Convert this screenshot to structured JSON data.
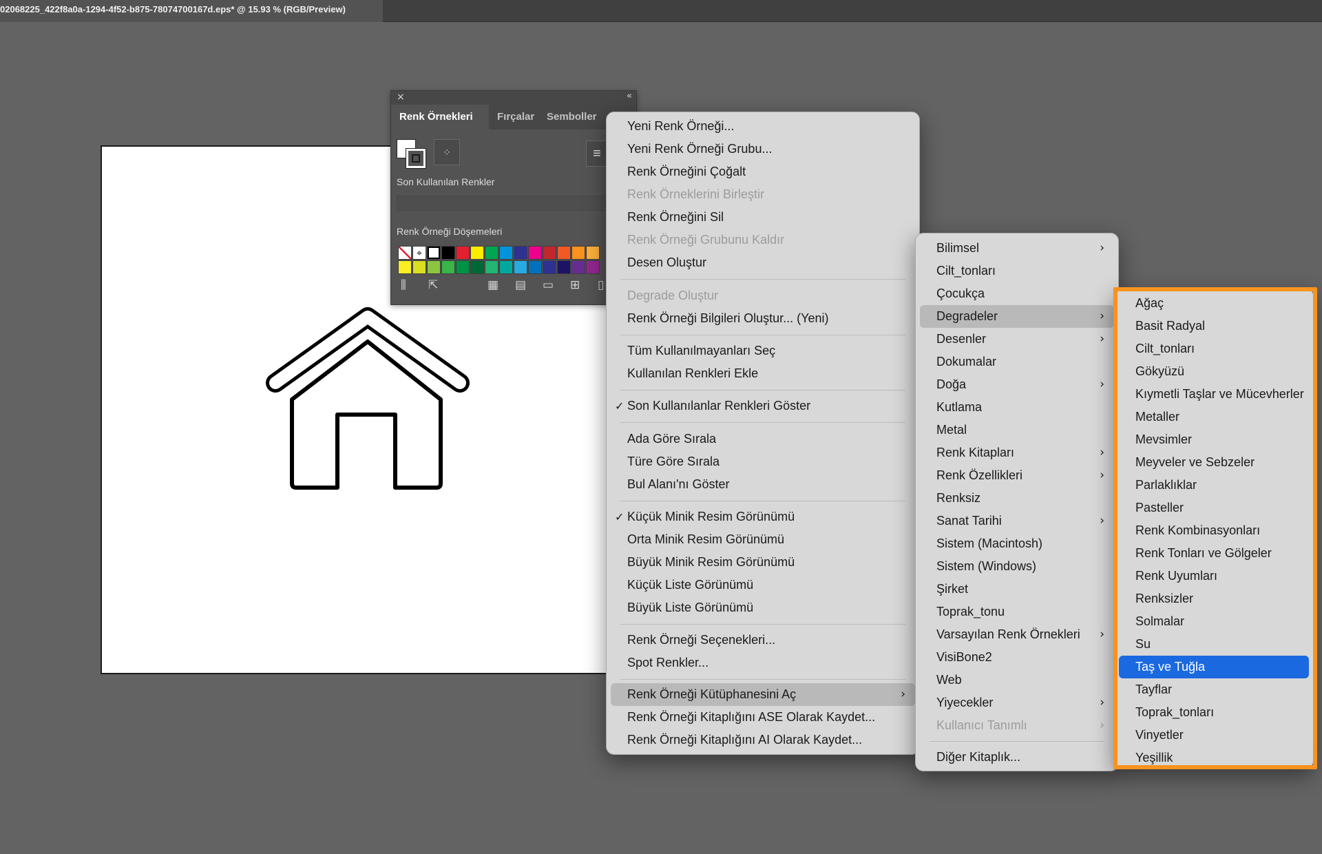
{
  "window": {
    "doc_tab_title": "02068225_422f8a0a-1294-4f52-b875-78074700167d.eps* @ 15.93 % (RGB/Preview)"
  },
  "panel": {
    "tabs": [
      "Renk Örnekleri",
      "Fırçalar",
      "Semboller"
    ],
    "recent_label": "Son Kullanılan Renkler",
    "swatches_label": "Renk Örneği Döşemeleri",
    "swatch_row1": [
      "none",
      "registration",
      "#ffffff",
      "#000000",
      "#e5202e",
      "#ffed00",
      "#00a651",
      "#0095da",
      "#2e3192",
      "#ec008c",
      "#c1272d",
      "#f15a24",
      "#f7931e",
      "#fbb03b"
    ],
    "swatch_row2": [
      "#fcee21",
      "#d9e021",
      "#8cc63f",
      "#39b54a",
      "#009245",
      "#006837",
      "#22b573",
      "#00a99d",
      "#29abe2",
      "#0071bc",
      "#2e3192",
      "#1b1464",
      "#662d91",
      "#93278f"
    ]
  },
  "main_menu": {
    "items": [
      "Yeni Renk Örneği...",
      "Yeni Renk Örneği Grubu...",
      "Renk Örneğini Çoğalt",
      "Renk Örneklerini Birleştir",
      "Renk Örneğini Sil",
      "Renk Örneği Grubunu Kaldır",
      "Desen Oluştur",
      "Degrade Oluştur",
      "Renk Örneği Bilgileri Oluştur... (Yeni)",
      "Tüm Kullanılmayanları Seç",
      "Kullanılan Renkleri Ekle",
      "Son Kullanılanlar Renkleri Göster",
      "Ada Göre Sırala",
      "Türe Göre Sırala",
      "Bul Alanı'nı Göster",
      "Küçük Minik Resim Görünümü",
      "Orta Minik Resim Görünümü",
      "Büyük Minik Resim Görünümü",
      "Küçük Liste Görünümü",
      "Büyük Liste Görünümü",
      "Renk Örneği Seçenekleri...",
      "Spot Renkler...",
      "Renk Örneği Kütüphanesini Aç",
      "Renk Örneği Kitaplığını ASE Olarak Kaydet...",
      "Renk Örneği Kitaplığını AI Olarak Kaydet..."
    ],
    "check_mark": "✓",
    "chevron": "›"
  },
  "library_menu": {
    "items": [
      "Bilimsel",
      "Cilt_tonları",
      "Çocukça",
      "Degradeler",
      "Desenler",
      "Dokumalar",
      "Doğa",
      "Kutlama",
      "Metal",
      "Renk Kitapları",
      "Renk Özellikleri",
      "Renksiz",
      "Sanat Tarihi",
      "Sistem (Macintosh)",
      "Sistem (Windows)",
      "Şirket",
      "Toprak_tonu",
      "Varsayılan Renk Örnekleri",
      "VisiBone2",
      "Web",
      "Yiyecekler",
      "Kullanıcı Tanımlı",
      "Diğer Kitaplık..."
    ]
  },
  "gradient_menu": {
    "items": [
      "Ağaç",
      "Basit Radyal",
      "Cilt_tonları",
      "Gökyüzü",
      "Kıymetli Taşlar ve Mücevherler",
      "Metaller",
      "Mevsimler",
      "Meyveler ve Sebzeler",
      "Parlaklıklar",
      "Pasteller",
      "Renk Kombinasyonları",
      "Renk Tonları ve Gölgeler",
      "Renk Uyumları",
      "Renksizler",
      "Solmalar",
      "Su",
      "Taş ve Tuğla",
      "Tayflar",
      "Toprak_tonları",
      "Vinyetler",
      "Yeşillik"
    ],
    "selected": "Taş ve Tuğla"
  },
  "colors": {
    "highlight_outline": "#f7931e",
    "selection_blue": "#1a69e0"
  }
}
